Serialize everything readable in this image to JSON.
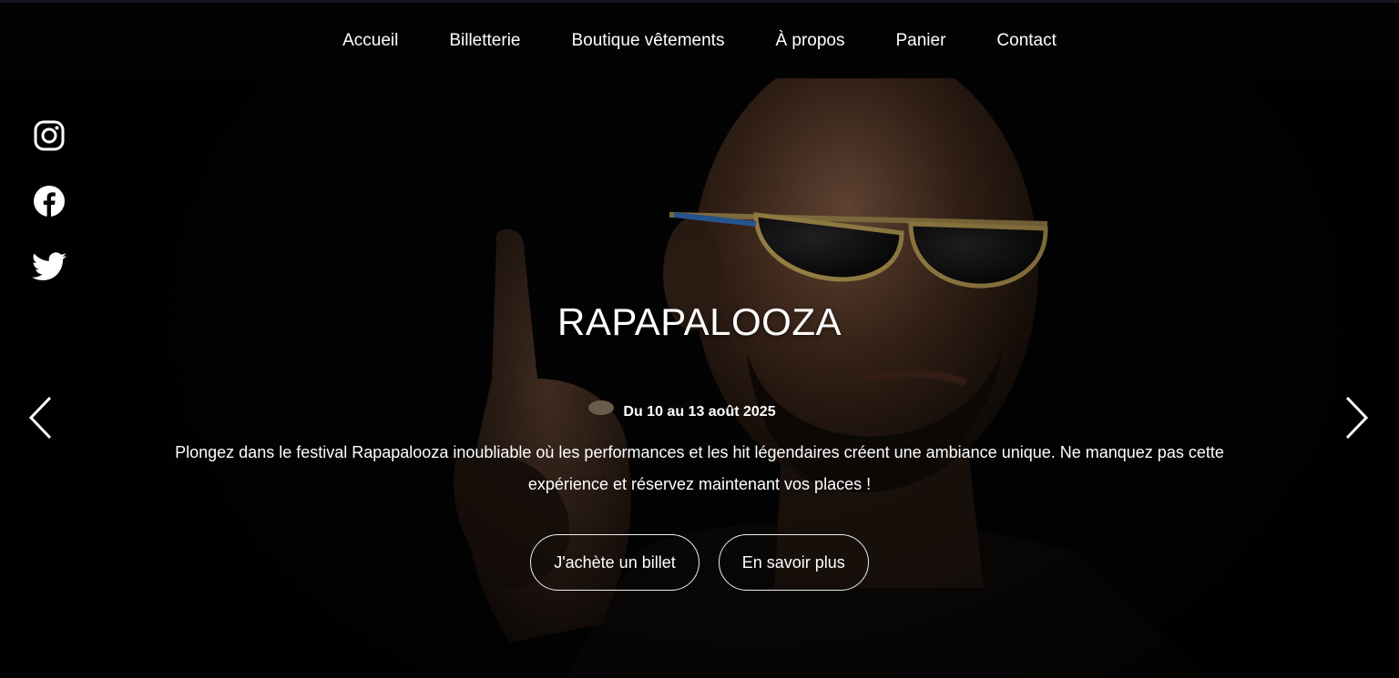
{
  "nav": {
    "items": [
      {
        "label": "Accueil"
      },
      {
        "label": "Billetterie"
      },
      {
        "label": "Boutique vêtements"
      },
      {
        "label": "À propos"
      },
      {
        "label": "Panier"
      },
      {
        "label": "Contact"
      }
    ]
  },
  "social": {
    "icons": [
      "instagram-icon",
      "facebook-icon",
      "twitter-icon"
    ]
  },
  "hero": {
    "title": "RAPAPALOOZA",
    "dates": "Du 10 au 13 août 2025",
    "description": "Plongez dans le festival Rapapalooza inoubliable où les performances et les hit légendaires créent une ambiance unique. Ne manquez pas cette expérience et réservez maintenant vos places !",
    "buy_label": "J'achète un billet",
    "more_label": "En savoir plus"
  },
  "carousel": {
    "prev_icon": "chevron-left-icon",
    "next_icon": "chevron-right-icon"
  },
  "colors": {
    "background": "#030303",
    "text": "#ffffff",
    "button_border": "#f0f0f0"
  }
}
